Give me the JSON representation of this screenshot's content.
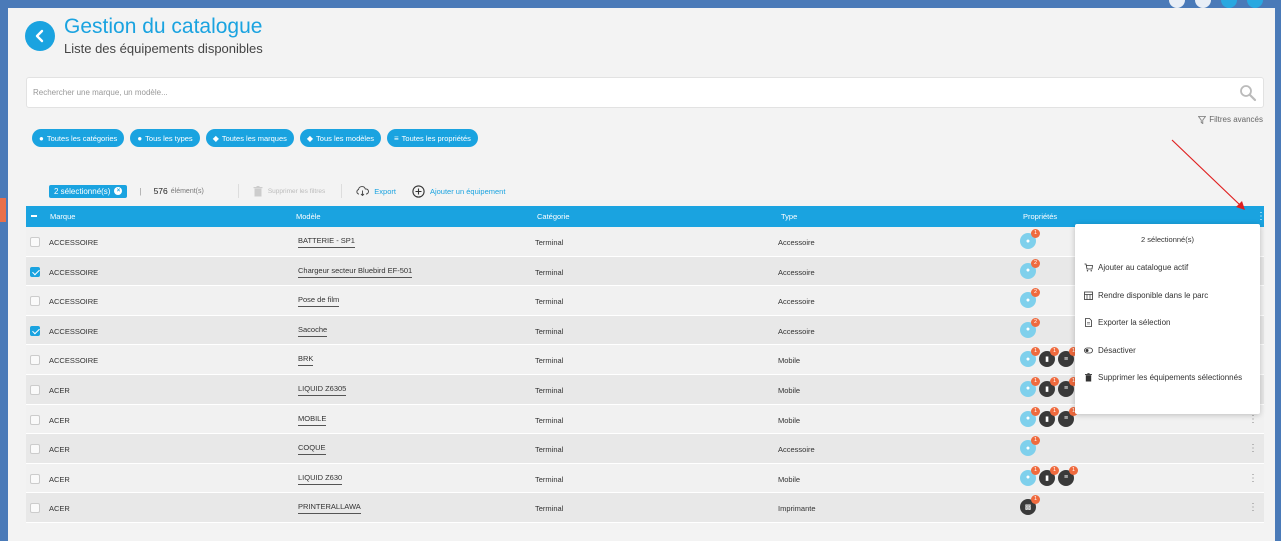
{
  "header": {
    "title": "Gestion du catalogue",
    "subtitle": "Liste des équipements disponibles"
  },
  "search": {
    "placeholder": "Rechercher une marque, un modèle..."
  },
  "filters": {
    "advanced_label": "Filtres avancés",
    "chips": [
      {
        "label": "Toutes les catégories"
      },
      {
        "label": "Tous les types"
      },
      {
        "label": "Toutes les marques"
      },
      {
        "label": "Tous les modèles"
      },
      {
        "label": "Toutes les propriétés"
      }
    ]
  },
  "toolbar": {
    "selected_label": "2 sélectionné(s)",
    "separator": "|",
    "count_number": "576",
    "count_label": "élément(s)",
    "clear_filters_label": "Supprimer les filtres",
    "export_label": "Export",
    "add_label": "Ajouter un équipement"
  },
  "table": {
    "columns": {
      "brand": "Marque",
      "model": "Modèle",
      "category": "Catégorie",
      "type": "Type",
      "properties": "Propriétés"
    },
    "rows": [
      {
        "brand": "ACCESSOIRE",
        "model": "BATTERIE - SP1",
        "category": "Terminal",
        "type": "Accessoire",
        "checked": false,
        "props": [
          {
            "icon": "tag",
            "badge": "1"
          }
        ]
      },
      {
        "brand": "ACCESSOIRE",
        "model": "Chargeur secteur Bluebird EF-501",
        "category": "Terminal",
        "type": "Accessoire",
        "checked": true,
        "props": [
          {
            "icon": "tag",
            "badge": "2"
          }
        ]
      },
      {
        "brand": "ACCESSOIRE",
        "model": "Pose de film",
        "category": "Terminal",
        "type": "Accessoire",
        "checked": false,
        "props": [
          {
            "icon": "tag",
            "badge": "2"
          }
        ]
      },
      {
        "brand": "ACCESSOIRE",
        "model": "Sacoche",
        "category": "Terminal",
        "type": "Accessoire",
        "checked": true,
        "props": [
          {
            "icon": "tag",
            "badge": "2"
          }
        ]
      },
      {
        "brand": "ACCESSOIRE",
        "model": "BRK",
        "category": "Terminal",
        "type": "Mobile",
        "checked": false,
        "props": [
          {
            "icon": "tag",
            "badge": "1"
          },
          {
            "icon": "sim",
            "badge": "1"
          },
          {
            "icon": "db",
            "badge": "1"
          }
        ]
      },
      {
        "brand": "ACER",
        "model": "LIQUID Z6305",
        "category": "Terminal",
        "type": "Mobile",
        "checked": false,
        "props": [
          {
            "icon": "tag",
            "badge": "1"
          },
          {
            "icon": "sim",
            "badge": "1"
          },
          {
            "icon": "db",
            "badge": "1"
          }
        ]
      },
      {
        "brand": "ACER",
        "model": "MOBILE",
        "category": "Terminal",
        "type": "Mobile",
        "checked": false,
        "props": [
          {
            "icon": "tag",
            "badge": "1"
          },
          {
            "icon": "sim",
            "badge": "1"
          },
          {
            "icon": "db",
            "badge": "1"
          }
        ]
      },
      {
        "brand": "ACER",
        "model": "COQUE",
        "category": "Terminal",
        "type": "Accessoire",
        "checked": false,
        "props": [
          {
            "icon": "tag",
            "badge": "1"
          }
        ]
      },
      {
        "brand": "ACER",
        "model": "LIQUID Z630",
        "category": "Terminal",
        "type": "Mobile",
        "checked": false,
        "props": [
          {
            "icon": "tag",
            "badge": "1"
          },
          {
            "icon": "sim",
            "badge": "1"
          },
          {
            "icon": "db",
            "badge": "1"
          }
        ]
      },
      {
        "brand": "ACER",
        "model": "PRINTERALLAWA",
        "category": "Terminal",
        "type": "Imprimante",
        "checked": false,
        "props": [
          {
            "icon": "printer",
            "badge": "1"
          }
        ]
      }
    ]
  },
  "dropdown": {
    "header": "2 sélectionné(s)",
    "items": [
      {
        "label": "Ajouter au catalogue actif",
        "icon": "cart-icon"
      },
      {
        "label": "Rendre disponible dans le parc",
        "icon": "warehouse-icon"
      },
      {
        "label": "Exporter la sélection",
        "icon": "file-icon"
      },
      {
        "label": "Désactiver",
        "icon": "toggle-icon"
      },
      {
        "label": "Supprimer les équipements sélectionnés",
        "icon": "trash-icon"
      }
    ]
  },
  "colors": {
    "accent": "#1aa3e0",
    "badge": "#ef6a3e",
    "annotation_arrow": "#e02020"
  }
}
